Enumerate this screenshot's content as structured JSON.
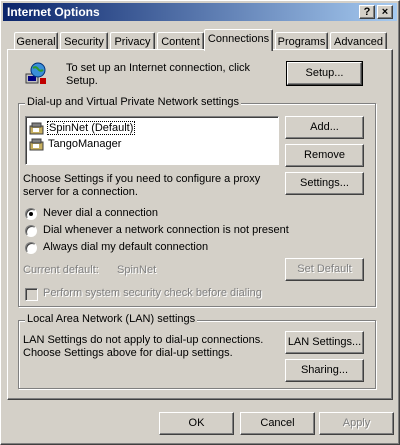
{
  "window": {
    "title": "Internet Options",
    "help_label": "?",
    "close_label": "×"
  },
  "tabs": [
    {
      "label": "General"
    },
    {
      "label": "Security"
    },
    {
      "label": "Privacy"
    },
    {
      "label": "Content"
    },
    {
      "label": "Connections",
      "active": true
    },
    {
      "label": "Programs"
    },
    {
      "label": "Advanced"
    }
  ],
  "setup": {
    "text_line1": "To set up an Internet connection, click",
    "text_line2": "Setup.",
    "button": "Setup..."
  },
  "dialup": {
    "group_label": "Dial-up and Virtual Private Network settings",
    "connections": [
      {
        "label": "SpinNet (Default)",
        "selected": true
      },
      {
        "label": "TangoManager"
      }
    ],
    "add_button": "Add...",
    "remove_button": "Remove",
    "settings_text_line1": "Choose Settings if you need to configure a proxy",
    "settings_text_line2": "server for a connection.",
    "settings_button": "Settings...",
    "options": [
      {
        "label": "Never dial a connection",
        "selected": true
      },
      {
        "label": "Dial whenever a network connection is not present"
      },
      {
        "label": "Always dial my default connection"
      }
    ],
    "current_default_label": "Current default:",
    "current_default_value": "SpinNet",
    "set_default_button": "Set Default",
    "security_check_label": "Perform system security check before dialing"
  },
  "lan": {
    "group_label": "Local Area Network (LAN) settings",
    "text_line1": "LAN Settings do not apply to dial-up connections.",
    "text_line2": "Choose Settings above for dial-up settings.",
    "lan_button": "LAN Settings...",
    "sharing_button": "Sharing..."
  },
  "footer": {
    "ok": "OK",
    "cancel": "Cancel",
    "apply": "Apply"
  }
}
